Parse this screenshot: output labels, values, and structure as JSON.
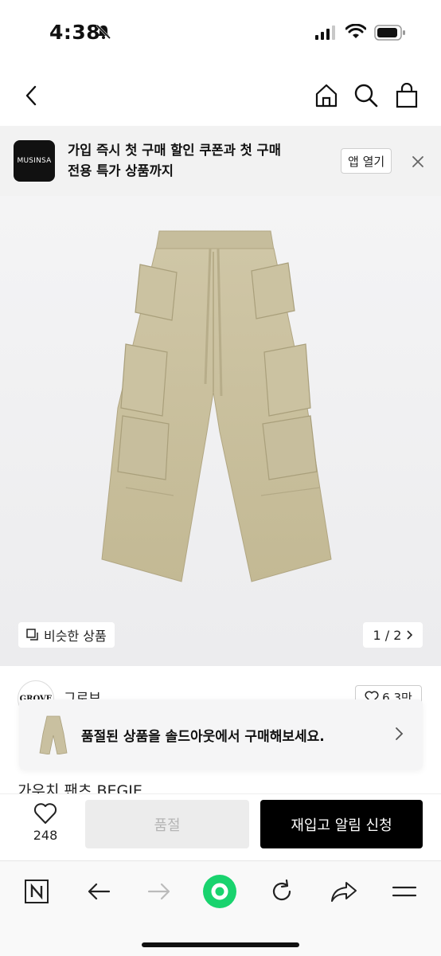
{
  "status": {
    "time": "4:38"
  },
  "header": {
    "back": "back",
    "icons": [
      "home-icon",
      "search-icon",
      "shopping-bag-icon"
    ]
  },
  "promo": {
    "logo_text": "MUSINSA",
    "line1": "가입 즉시 첫 구매 할인 쿠폰과 첫 구매",
    "line2": "전용 특가 상품까지",
    "open_label": "앱 열기"
  },
  "gallery": {
    "similar_label": "비슷한 상품",
    "page_indicator": "1 / 2"
  },
  "brand": {
    "logo_text": "GROVE",
    "name": "그로브",
    "likes": "6.3만"
  },
  "product": {
    "title": "가우치 팬츠 BEGIE"
  },
  "soldout_notice": {
    "text": "품절된 상품을 솔드아웃에서 구매해보세요."
  },
  "buy_bar": {
    "heart_count": "248",
    "soldout_label": "품절",
    "restock_label": "재입고 알림 신청"
  },
  "colors": {
    "accent_green": "#19d36e",
    "dark": "#000000",
    "pants": "#c9c0a0"
  }
}
